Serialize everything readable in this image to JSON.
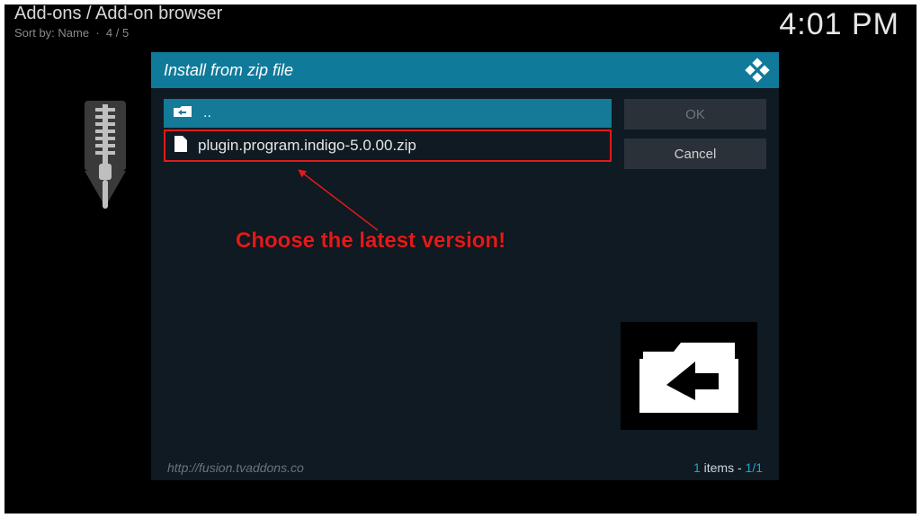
{
  "header": {
    "breadcrumb": "Add-ons / Add-on browser",
    "sort_label": "Sort by: Name",
    "position": "4 / 5"
  },
  "clock": "4:01 PM",
  "dialog": {
    "title": "Install from zip file",
    "parent_label": "..",
    "files": [
      {
        "name": "plugin.program.indigo-5.0.00.zip"
      }
    ],
    "ok_label": "OK",
    "cancel_label": "Cancel",
    "footer_url": "http://fusion.tvaddons.co",
    "footer_count_text": "items -",
    "footer_count_n": "1",
    "footer_count_pos": "1/1"
  },
  "annotation": {
    "text": "Choose the latest version!"
  }
}
